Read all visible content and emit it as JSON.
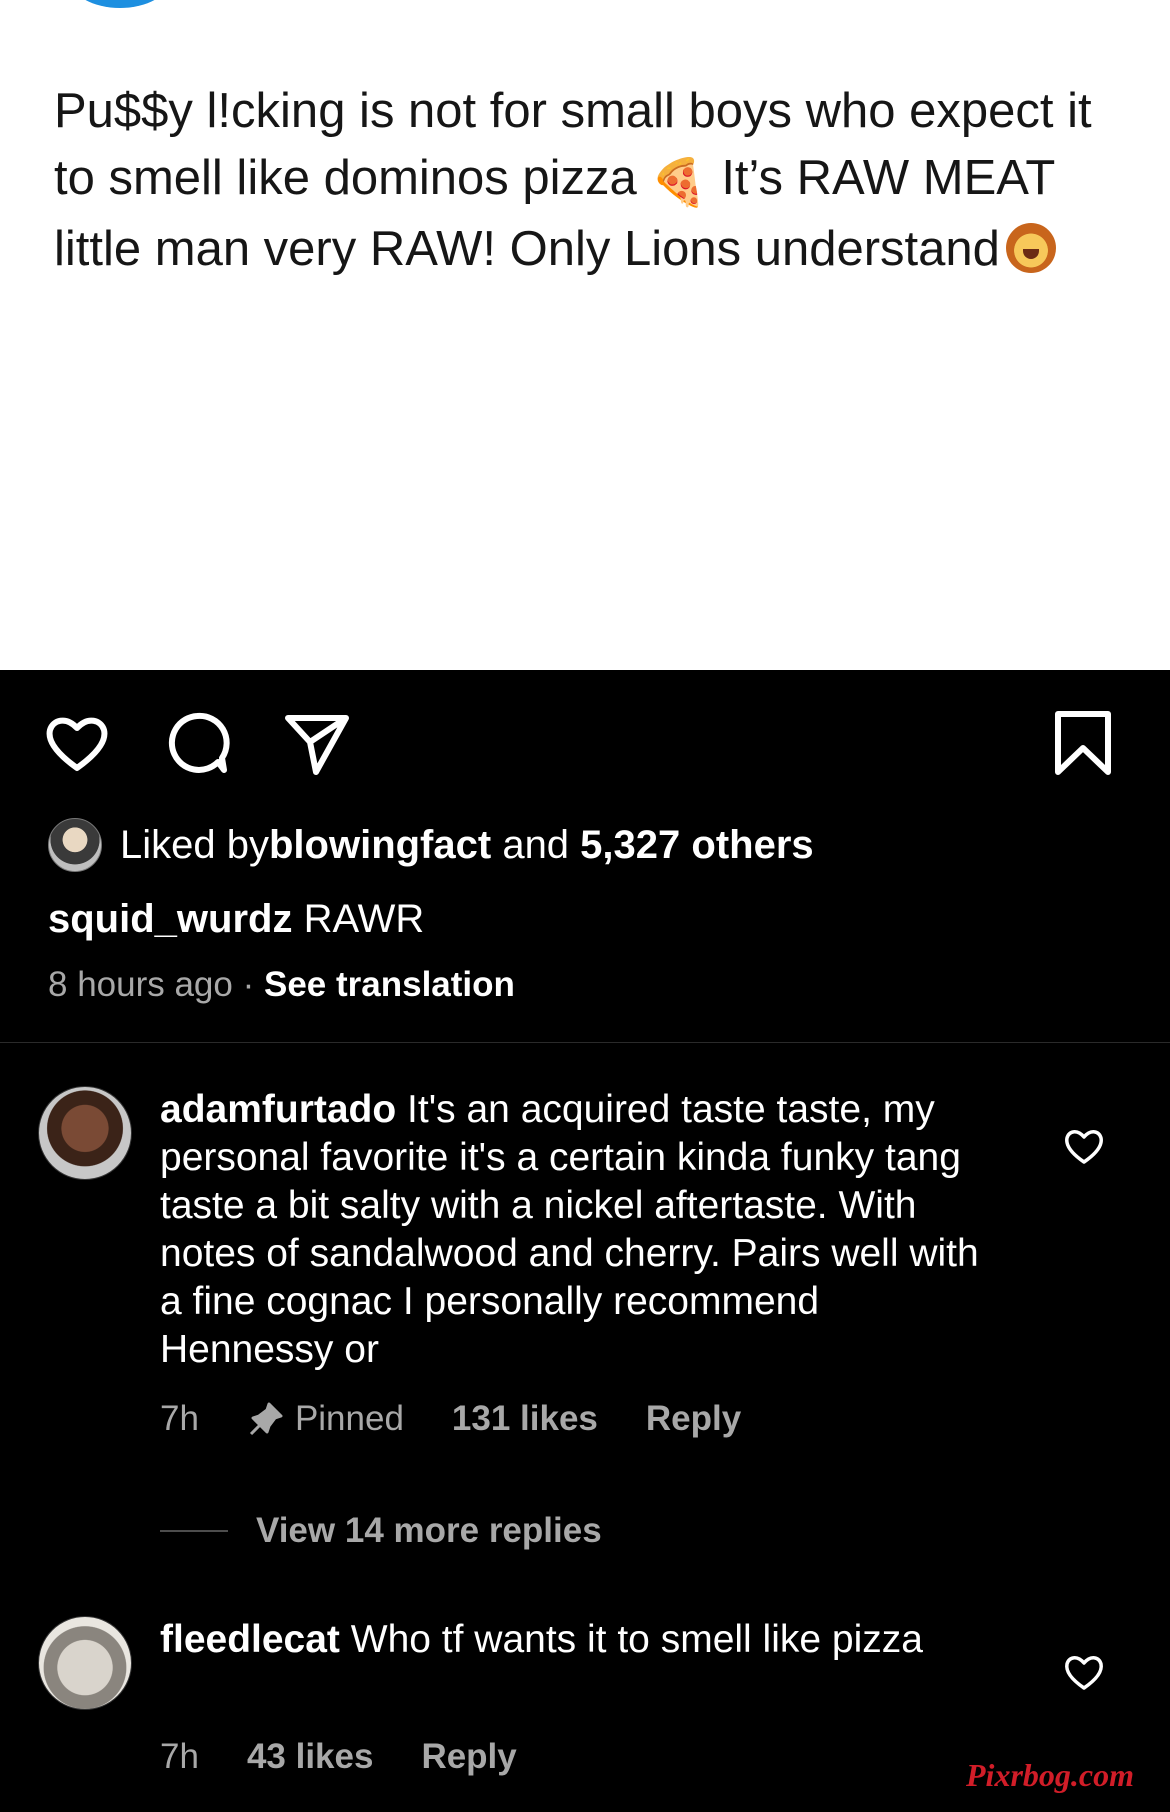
{
  "post": {
    "text_part1": "Pu$$y l!cking is not for small boys who expect it to smell like dominos pizza",
    "pizza_emoji": "🍕",
    "text_part2": " It’s RAW MEAT little man very RAW! Only Lions understand",
    "lion_emoji_icon": "lion-face-icon"
  },
  "liked": {
    "prefix": "Liked by ",
    "user": "blowingfact",
    "middle": " and ",
    "count": "5,327 others"
  },
  "caption": {
    "user": "squid_wurdz",
    "text": " RAWR"
  },
  "meta": {
    "time": "8 hours ago",
    "dot": " · ",
    "translate": "See translation"
  },
  "comments": [
    {
      "user": "adamfurtado",
      "text": " It's an acquired taste taste, my personal favorite it's a certain kinda funky tang taste a bit salty with a nickel aftertaste. With notes of sandalwood and cherry. Pairs well with a fine cognac I personally recommend Hennessy or",
      "time": "7h",
      "pinned": "Pinned",
      "likes": "131 likes",
      "reply": "Reply"
    },
    {
      "user": "fleedlecat",
      "text": " Who tf wants it to smell like pizza",
      "time": "7h",
      "likes": "43 likes",
      "reply": "Reply"
    }
  ],
  "view_more": "View 14 more replies",
  "watermark": "Pixrbog.com"
}
